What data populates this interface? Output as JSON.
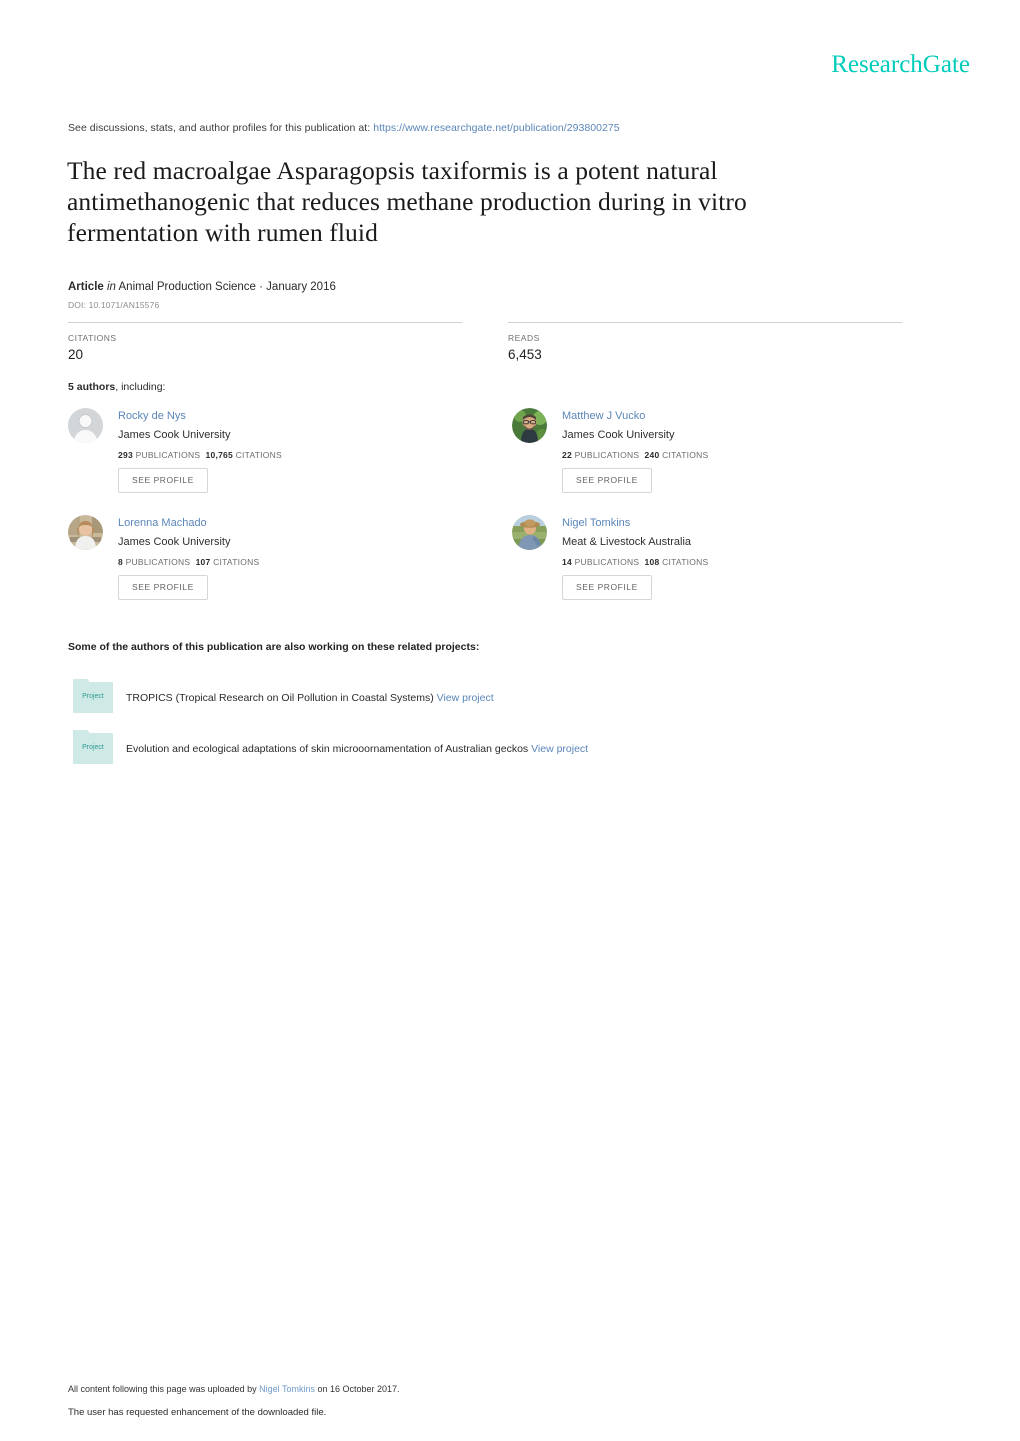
{
  "brand": {
    "logo_text": "ResearchGate",
    "logo_color": "#00ccbb",
    "link_color": "#5b86b8"
  },
  "header": {
    "see_prefix": "See discussions, stats, and author profiles for this publication at:",
    "publication_url": "https://www.researchgate.net/publication/293800275"
  },
  "publication": {
    "title": "The red macroalgae Asparagopsis taxiformis is a potent natural antimethanogenic that reduces methane production during in vitro fermentation with rumen fluid",
    "type_label": "Article",
    "in_label": "in",
    "journal_and_date": "Animal Production Science · January 2016",
    "doi": "DOI: 10.1071/AN15576"
  },
  "stats": {
    "citations_label": "CITATIONS",
    "citations_value": "20",
    "reads_label": "READS",
    "reads_value": "6,453"
  },
  "authors_section": {
    "count_text": "5 authors",
    "including_text": ", including:",
    "see_profile_label": "SEE PROFILE",
    "publications_label": "PUBLICATIONS",
    "citations_label": "CITATIONS",
    "authors": [
      {
        "name": "Rocky de Nys",
        "institution": "James Cook University",
        "publications": "293",
        "citations": "10,765",
        "avatar": "placeholder-avatar"
      },
      {
        "name": "Matthew J Vucko",
        "institution": "James Cook University",
        "publications": "22",
        "citations": "240",
        "avatar": "photo-avatar-green"
      },
      {
        "name": "Lorenna Machado",
        "institution": "James Cook University",
        "publications": "8",
        "citations": "107",
        "avatar": "photo-avatar-lab"
      },
      {
        "name": "Nigel Tomkins",
        "institution": "Meat & Livestock Australia",
        "publications": "14",
        "citations": "108",
        "avatar": "photo-avatar-field"
      }
    ]
  },
  "projects_section": {
    "heading": "Some of the authors of this publication are also working on these related projects:",
    "icon_label": "Project",
    "view_project_label": "View project",
    "projects": [
      {
        "title": "TROPICS (Tropical Research on Oil Pollution in Coastal Systems)"
      },
      {
        "title": "Evolution and ecological adaptations of skin microoornamentation of Australian geckos"
      }
    ]
  },
  "footer": {
    "uploaded_prefix": "All content following this page was uploaded by ",
    "uploaded_by": "Nigel Tomkins",
    "uploaded_suffix": " on 16 October 2017.",
    "enhancement_note": "The user has requested enhancement of the downloaded file."
  }
}
